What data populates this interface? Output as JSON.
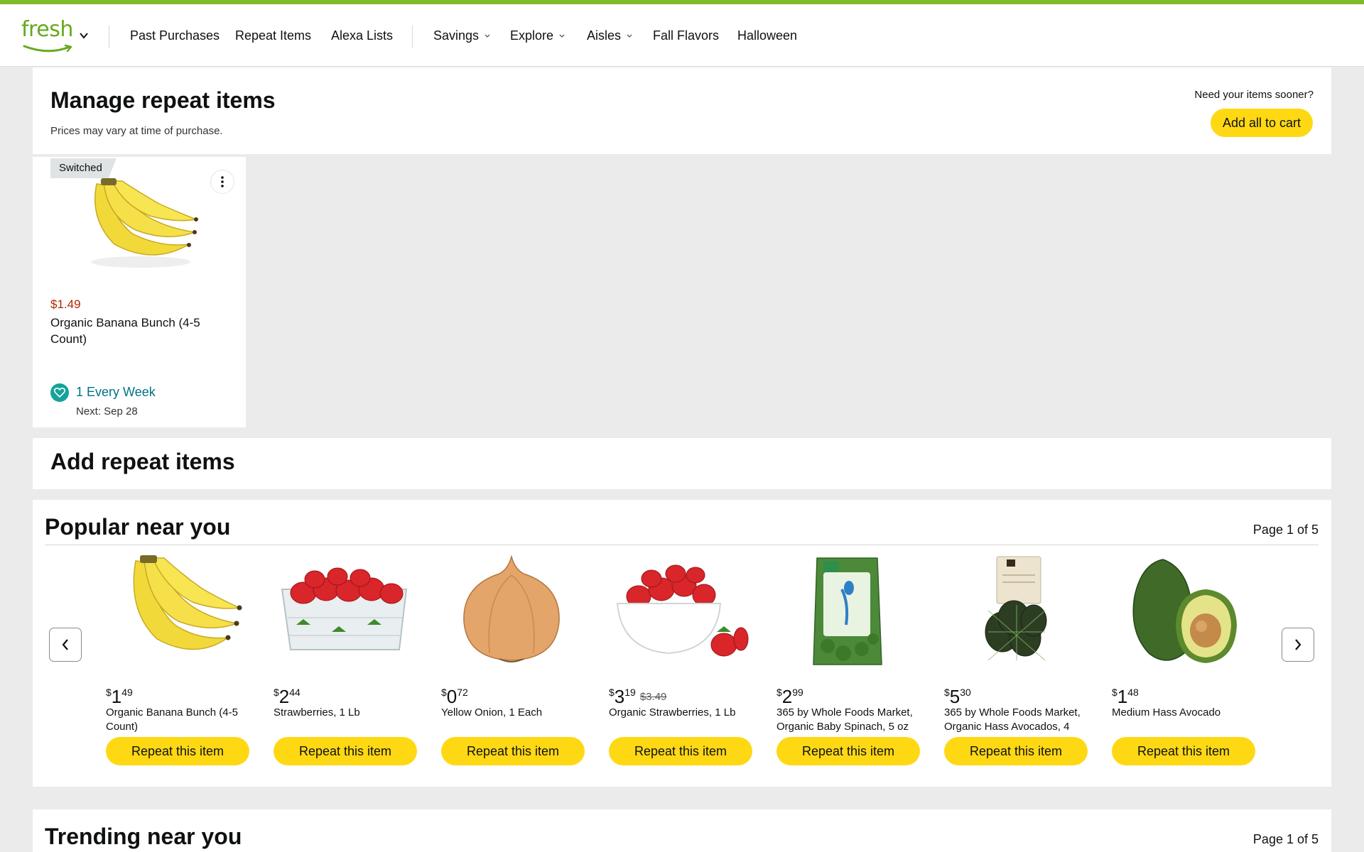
{
  "colors": {
    "accent_green": "#7fbb2a",
    "button_yellow": "#ffd814",
    "price_red": "#b12704",
    "link_teal": "#007185"
  },
  "nav": {
    "logo_text": "fresh",
    "items": [
      {
        "label": "Past Purchases",
        "dropdown": false
      },
      {
        "label": "Repeat Items",
        "dropdown": false
      },
      {
        "label": "Alexa Lists",
        "dropdown": false
      },
      {
        "label": "Savings",
        "dropdown": true
      },
      {
        "label": "Explore",
        "dropdown": true
      },
      {
        "label": "Aisles",
        "dropdown": true
      },
      {
        "label": "Fall Flavors",
        "dropdown": false
      },
      {
        "label": "Halloween",
        "dropdown": false
      }
    ]
  },
  "manage": {
    "title": "Manage repeat items",
    "subtitle": "Prices may vary at time of purchase.",
    "need_sooner": "Need your items sooner?",
    "add_all_label": "Add all to cart"
  },
  "repeat_card": {
    "tag": "Switched",
    "price": "$1.49",
    "name": "Organic Banana Bunch (4-5 Count)",
    "frequency": "1 Every Week",
    "next": "Next: Sep 28",
    "icon": "heart-repeat-icon"
  },
  "add_repeat": {
    "title": "Add repeat items"
  },
  "popular": {
    "title": "Popular near you",
    "page": "Page 1 of 5",
    "products": [
      {
        "dollars": "1",
        "cents": "49",
        "was": "",
        "name": "Organic Banana Bunch (4-5 Count)",
        "button": "Repeat this item",
        "image": "banana"
      },
      {
        "dollars": "2",
        "cents": "44",
        "was": "",
        "name": "Strawberries, 1 Lb",
        "button": "Repeat this item",
        "image": "strawberry-box"
      },
      {
        "dollars": "0",
        "cents": "72",
        "was": "",
        "name": "Yellow Onion, 1 Each",
        "button": "Repeat this item",
        "image": "onion"
      },
      {
        "dollars": "3",
        "cents": "19",
        "was": "$3.49",
        "name": "Organic Strawberries, 1 Lb",
        "button": "Repeat this item",
        "image": "strawberry-bowl"
      },
      {
        "dollars": "2",
        "cents": "99",
        "was": "",
        "name": "365 by Whole Foods Market, Organic Baby Spinach, 5 oz",
        "button": "Repeat this item",
        "image": "spinach"
      },
      {
        "dollars": "5",
        "cents": "30",
        "was": "",
        "name": "365 by Whole Foods Market, Organic Hass Avocados, 4",
        "button": "Repeat this item",
        "image": "avocado-bag"
      },
      {
        "dollars": "1",
        "cents": "48",
        "was": "",
        "name": "Medium Hass Avocado",
        "button": "Repeat this item",
        "image": "avocado"
      }
    ]
  },
  "trending": {
    "title": "Trending near you",
    "page": "Page 1 of 5"
  }
}
